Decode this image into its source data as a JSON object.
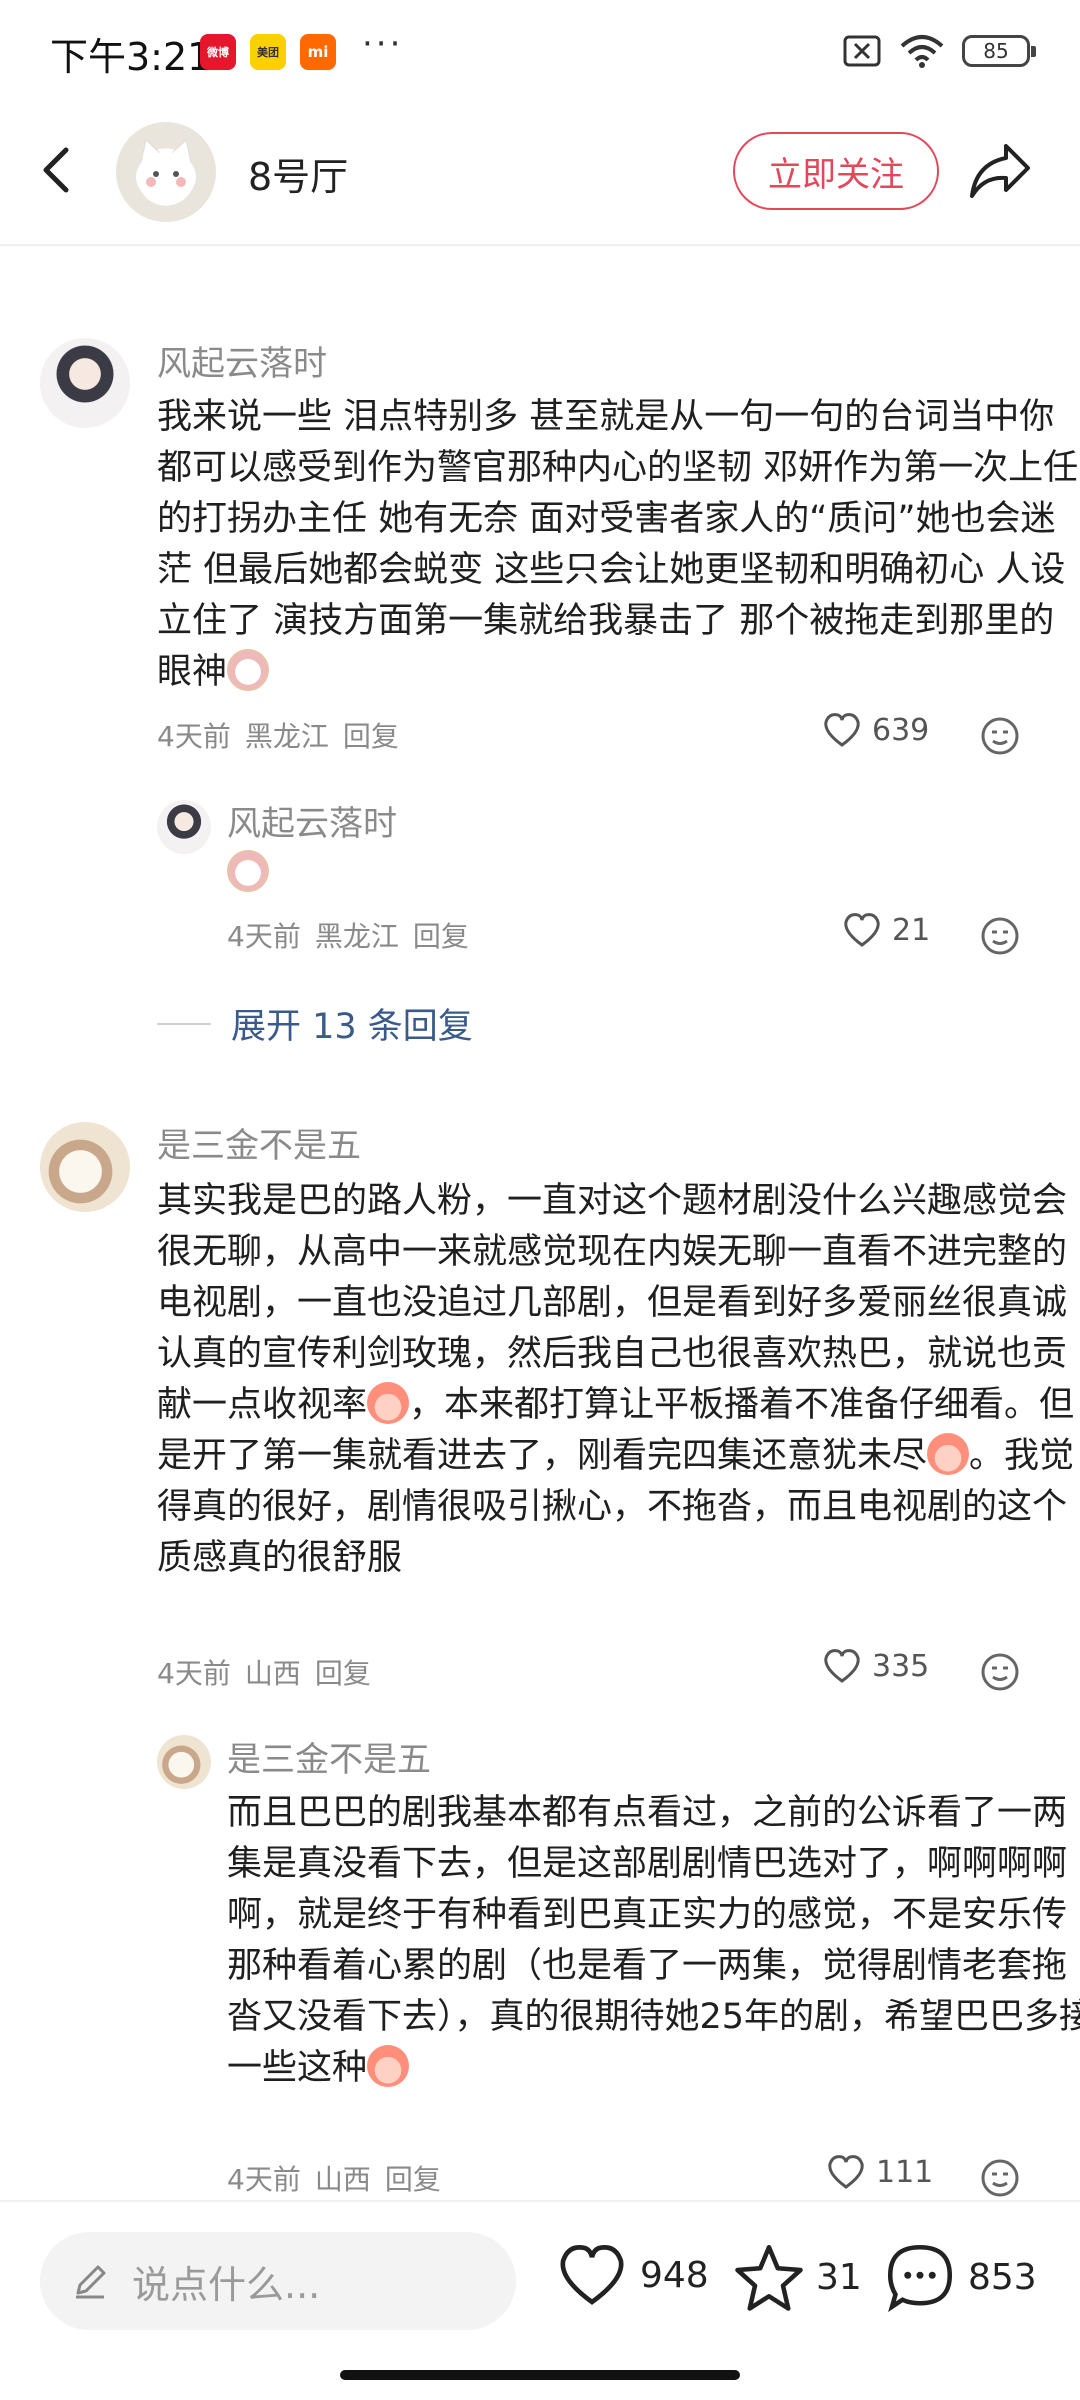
{
  "status_bar": {
    "time": "下午3:21",
    "battery": "85",
    "app_labels": [
      "微博",
      "美团",
      "mi"
    ]
  },
  "header": {
    "title": "8号厅",
    "follow_label": "立即关注"
  },
  "comments": [
    {
      "username": "风起云落时",
      "text": "我来说一些 泪点特别多 甚至就是从一句一句的台词当中你都可以感受到作为警官那种内心的坚韧 邓妍作为第一次上任的打拐办主任 她有无奈 面对受害者家人的“质问”她也会迷茫 但最后她都会蜕变 这些只会让她更坚韧和明确初心 人设立住了 演技方面第一集就给我暴击了 那个被拖走到那里的眼神",
      "time": "4天前",
      "location": "黑龙江",
      "reply_label": "回复",
      "likes": "639",
      "reply": {
        "username": "风起云落时",
        "time": "4天前",
        "location": "黑龙江",
        "reply_label": "回复",
        "likes": "21"
      },
      "expand_label": "展开 13 条回复"
    },
    {
      "username": "是三金不是五",
      "text_part1": "其实我是巴的路人粉，一直对这个题材剧没什么兴趣感觉会很无聊，从高中一来就感觉现在内娱无聊一直看不进完整的电视剧，一直也没追过几部剧，但是看到好多爱丽丝很真诚认真的宣传利剑玫瑰，然后我自己也很喜欢热巴，就说也贡献一点收视率",
      "text_part2": "，本来都打算让平板播着不准备仔细看。但是开了第一集就看进去了，刚看完四集还意犹未尽",
      "text_part3": "。我觉得真的很好，剧情很吸引揪心，不拖沓，而且电视剧的这个质感真的很舒服",
      "time": "4天前",
      "location": "山西",
      "reply_label": "回复",
      "likes": "335",
      "reply": {
        "username": "是三金不是五",
        "text": "而且巴巴的剧我基本都有点看过，之前的公诉看了一两集是真没看下去，但是这部剧剧情巴选对了，啊啊啊啊啊，就是终于有种看到巴真正实力的感觉，不是安乐传那种看着心累的剧（也是看了一两集，觉得剧情老套拖沓又没看下去），真的很期待她25年的剧，希望巴巴多接一些这种",
        "time": "4天前",
        "location": "山西",
        "reply_label": "回复",
        "likes": "111"
      }
    }
  ],
  "bottom_bar": {
    "placeholder": "说点什么...",
    "likes": "948",
    "favorites": "31",
    "comments": "853"
  },
  "colors": {
    "accent": "#e2475a",
    "link": "#3a5a8c",
    "muted": "#8a8a8a"
  }
}
